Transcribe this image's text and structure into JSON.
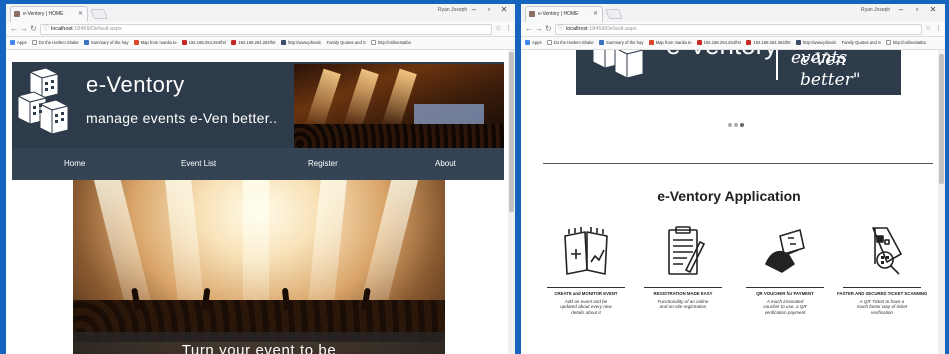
{
  "left_window": {
    "tab_title": "e-Ventory | HOME",
    "user_name": "Ryan Joseph",
    "url_host": "localhost",
    "url_path": ":18459/Default.aspx",
    "bookmarks": [
      "Apps",
      "Do the Harlem Shake",
      "Summary of the hay",
      "Map from manila to",
      "192.168.254.254/htr",
      "192.168.254.254/htr",
      "http://www.phivolc",
      "Family Quotes and S",
      "http://onlinestatbo"
    ],
    "header": {
      "brand": "e-Ventory",
      "tagline": "manage events e-Ven better.."
    },
    "nav": [
      "Home",
      "Event List",
      "Register",
      "About"
    ],
    "hero_caption": "Turn your event to be"
  },
  "right_window": {
    "tab_title": "e-Ventory | HOME",
    "user_name": "Ryan Joseph",
    "url_host": "localhost",
    "url_path": ":18459/Default.aspx",
    "bookmarks": [
      "Apps",
      "Do the Harlem Shake",
      "Summary of the hay",
      "Map from manila to",
      "192.168.254.254/htr",
      "192.168.254.254/htr",
      "http://www.phivolc",
      "Family Quotes and S",
      "http://onlinestatbo"
    ],
    "banner": {
      "brand": "e-Ventory",
      "quote_line1": "manage events",
      "quote_line2": "e-Ven better\""
    },
    "carousel_dots": 3,
    "section_title": "e-Ventory Application",
    "features": [
      {
        "icon": "calendar-icon",
        "title": "CREATE and MONITOR EVENT",
        "desc": "Add an event and be updated about every new details about it"
      },
      {
        "icon": "clipboard-icon",
        "title": "REGISTRATION MADE EASY",
        "desc": "Functionality of an online and on-site registration"
      },
      {
        "icon": "voucher-icon",
        "title": "QR VOUCHER for PAYMENT",
        "desc": "A much innovated voucher to use, a QR verification payment"
      },
      {
        "icon": "qr-ticket-icon",
        "title": "FASTER AND SECURED TICKET SCANNING",
        "desc": "A QR Ticket to have a much faster way of ticket verification"
      }
    ]
  },
  "colors": {
    "header_bg": "#2d3b4a",
    "nav_bg": "#344454",
    "desktop_bg": "#1565c0"
  }
}
